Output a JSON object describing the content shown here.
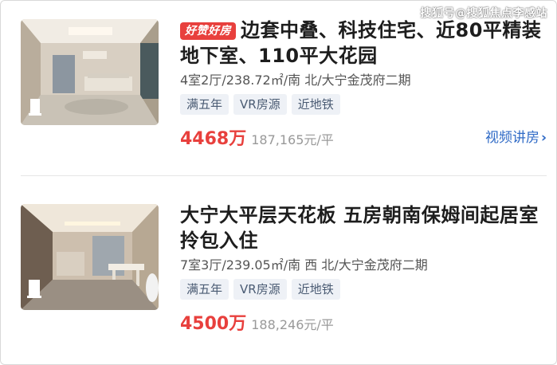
{
  "watermark": "搜狐号@搜狐焦点李感站",
  "listings": [
    {
      "badge": "好赞好房",
      "title": "边套中叠、科技住宅、近80平精装地下室、110平大花园",
      "meta": "4室2厅/238.72㎡/南 北/大宁金茂府二期",
      "tags": [
        "满五年",
        "VR房源",
        "近地铁"
      ],
      "price": "4468万",
      "unit_price": "187,165元/平",
      "video_link": "视频讲房",
      "video_icon": "chevron-right-icon"
    },
    {
      "title": "大宁大平层天花板 五房朝南保姆间起居室 拎包入住",
      "meta": "7室3厅/239.05㎡/南 西 北/大宁金茂府二期",
      "tags": [
        "满五年",
        "VR房源",
        "近地铁"
      ],
      "price": "4500万",
      "unit_price": "188,246元/平"
    }
  ],
  "colors": {
    "accent_red": "#e8403d",
    "link_blue": "#2f6ac6",
    "tag_bg": "#eef1f6",
    "tag_text": "#4a5b73"
  }
}
